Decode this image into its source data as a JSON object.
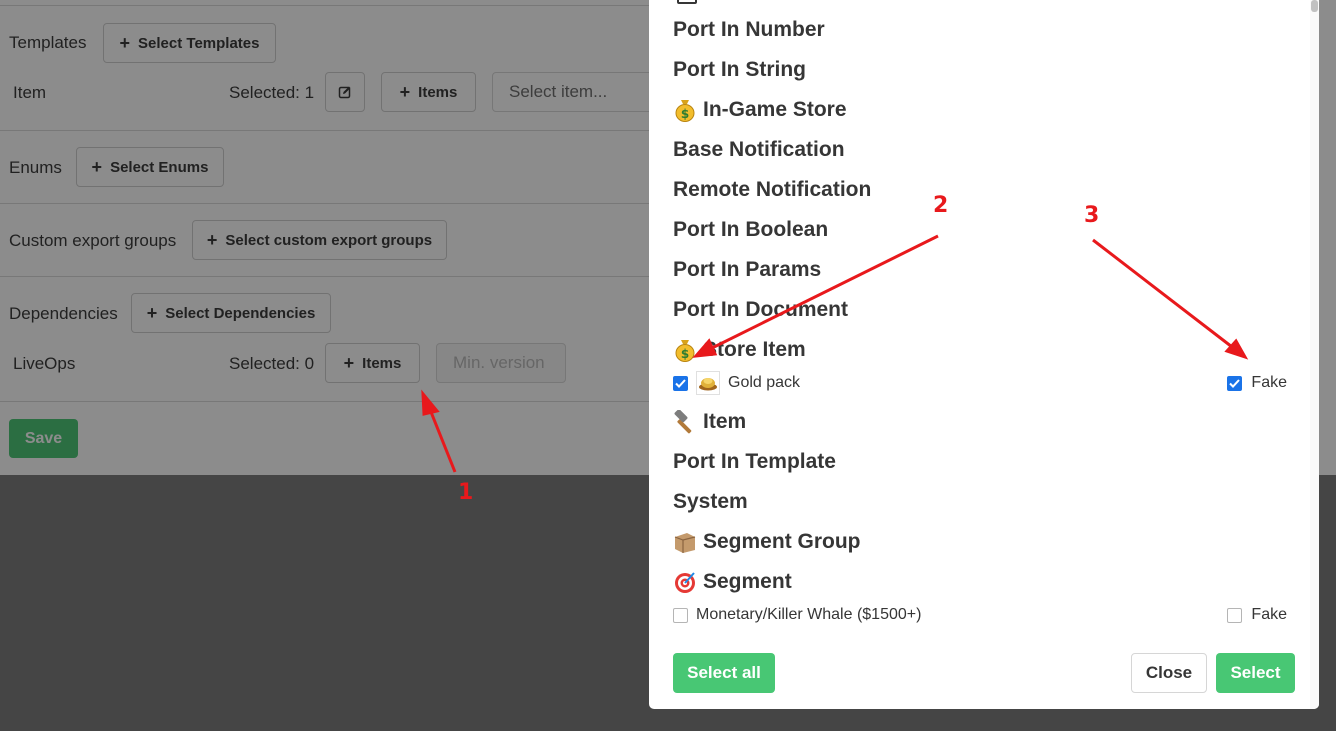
{
  "page": {
    "templates": {
      "label": "Templates",
      "button": "Select Templates"
    },
    "item_row": {
      "label": "Item",
      "selected": "Selected: 1",
      "items_button": "Items",
      "select_placeholder": "Select item..."
    },
    "enums": {
      "label": "Enums",
      "button": "Select Enums"
    },
    "custom_export": {
      "label": "Custom export groups",
      "button": "Select custom export groups"
    },
    "dependencies": {
      "label": "Dependencies",
      "button": "Select Dependencies"
    },
    "liveops_row": {
      "label": "LiveOps",
      "selected": "Selected: 0",
      "items_button": "Items",
      "min_version_placeholder": "Min. version"
    },
    "save_label": "Save"
  },
  "modal": {
    "groups": [
      {
        "label": "Port In Number",
        "icon": ""
      },
      {
        "label": "Port In String",
        "icon": ""
      },
      {
        "label": "In-Game Store",
        "icon": "money-bag-icon"
      },
      {
        "label": "Base Notification",
        "icon": ""
      },
      {
        "label": "Remote Notification",
        "icon": ""
      },
      {
        "label": "Port In Boolean",
        "icon": ""
      },
      {
        "label": "Port In Params",
        "icon": ""
      },
      {
        "label": "Port In Document",
        "icon": ""
      },
      {
        "label": "Store Item",
        "icon": "money-bag-icon"
      },
      {
        "label": "Item",
        "icon": "hammer-icon"
      },
      {
        "label": "Port In Template",
        "icon": ""
      },
      {
        "label": "System",
        "icon": ""
      },
      {
        "label": "Segment Group",
        "icon": "box-icon"
      },
      {
        "label": "Segment",
        "icon": "target-icon"
      }
    ],
    "store_item_entry": {
      "name": "Gold pack",
      "checked": true,
      "fake_label": "Fake",
      "fake_checked": true
    },
    "segment_entry": {
      "name": "Monetary/Killer Whale ($1500+)",
      "checked": false,
      "fake_label": "Fake",
      "fake_checked": false
    },
    "select_all_label": "Select all",
    "close_label": "Close",
    "select_label": "Select"
  },
  "annotations": {
    "n1": "1",
    "n2": "2",
    "n3": "3",
    "color": "#e8191c"
  },
  "colors": {
    "green": "#48c774",
    "checkbox_blue": "#1a73e8"
  }
}
